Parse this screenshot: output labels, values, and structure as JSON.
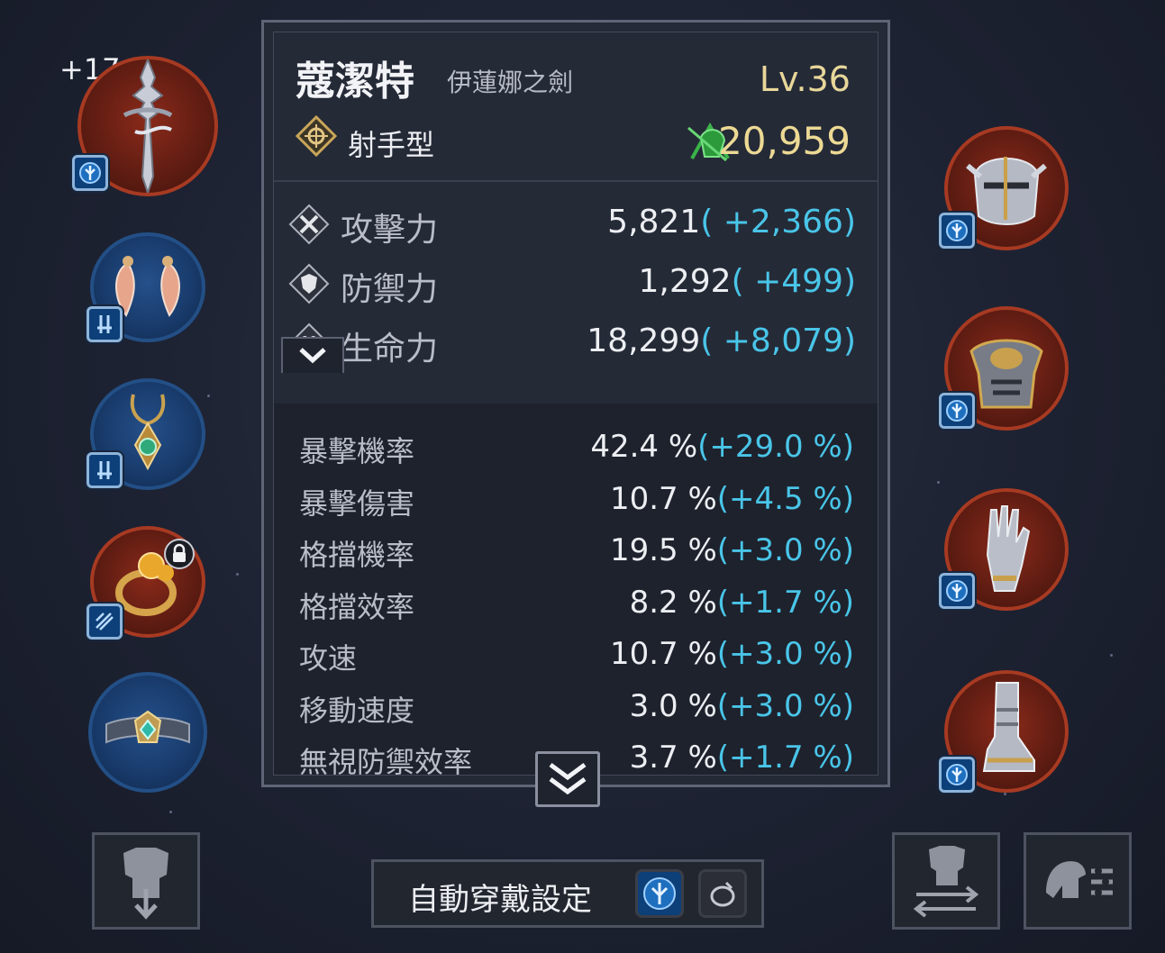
{
  "character": {
    "name": "蔻潔特",
    "title": "伊蓮娜之劍",
    "level": "Lv.36",
    "class": "射手型",
    "combat_power": "20,959"
  },
  "main_stats": [
    {
      "label": "攻擊力",
      "value": "5,821",
      "bonus": "( +2,366)",
      "icon": "attack-icon"
    },
    {
      "label": "防禦力",
      "value": "1,292",
      "bonus": "( +499)",
      "icon": "defense-icon"
    },
    {
      "label": "生命力",
      "value": "18,299",
      "bonus": "( +8,079)",
      "icon": "life-icon"
    }
  ],
  "sub_stats": [
    {
      "label": "暴擊機率",
      "value": "42.4 %",
      "bonus": "(+29.0 %)"
    },
    {
      "label": "暴擊傷害",
      "value": "10.7 %",
      "bonus": "(+4.5 %)"
    },
    {
      "label": "格擋機率",
      "value": "19.5 %",
      "bonus": "(+3.0 %)"
    },
    {
      "label": "格擋效率",
      "value": "8.2 %",
      "bonus": "(+1.7 %)"
    },
    {
      "label": "攻速",
      "value": "10.7 %",
      "bonus": "(+3.0 %)"
    },
    {
      "label": "移動速度",
      "value": "3.0 %",
      "bonus": "(+3.0 %)"
    },
    {
      "label": "無視防禦效率",
      "value": "3.7 %",
      "bonus": "(+1.7 %)"
    }
  ],
  "equipment": {
    "weapon_enhance": "+17",
    "left_slots": [
      "weapon",
      "earrings",
      "necklace",
      "ring",
      "belt"
    ],
    "right_slots": [
      "helmet",
      "chest-armor",
      "gloves",
      "boots"
    ]
  },
  "buttons": {
    "auto_equip_label": "自動穿戴設定"
  },
  "colors": {
    "bonus": "#49c5e8",
    "level": "#e8d79a",
    "power": "#ecd994",
    "slot_red": "#a73a22",
    "slot_blue": "#234f86"
  }
}
